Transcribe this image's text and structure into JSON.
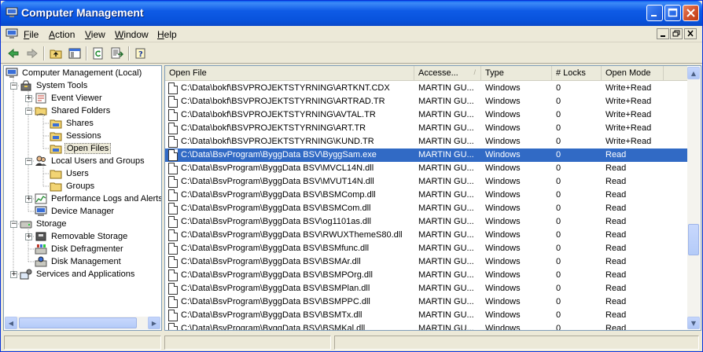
{
  "window": {
    "title": "Computer Management",
    "accent": "#0A5FEE",
    "selection_color": "#316AC5"
  },
  "menu": {
    "items": [
      "File",
      "Action",
      "View",
      "Window",
      "Help"
    ]
  },
  "toolbar": {
    "icons": [
      "back-icon",
      "forward-icon",
      "up-folder-icon",
      "show-hide-tree-icon",
      "refresh-icon",
      "export-list-icon",
      "help-icon"
    ]
  },
  "tree": {
    "items": [
      {
        "label": "Computer Management (Local)",
        "icon": "computer-icon"
      },
      {
        "label": "System Tools",
        "icon": "tools-icon"
      },
      {
        "label": "Event Viewer",
        "icon": "event-viewer-icon"
      },
      {
        "label": "Shared Folders",
        "icon": "shared-folder-icon"
      },
      {
        "label": "Shares",
        "icon": "folder-icon"
      },
      {
        "label": "Sessions",
        "icon": "folder-icon"
      },
      {
        "label": "Open Files",
        "icon": "folder-icon"
      },
      {
        "label": "Local Users and Groups",
        "icon": "users-icon"
      },
      {
        "label": "Users",
        "icon": "folder-icon"
      },
      {
        "label": "Groups",
        "icon": "folder-icon"
      },
      {
        "label": "Performance Logs and Alerts",
        "icon": "performance-icon"
      },
      {
        "label": "Device Manager",
        "icon": "device-manager-icon"
      },
      {
        "label": "Storage",
        "icon": "storage-icon"
      },
      {
        "label": "Removable Storage",
        "icon": "removable-storage-icon"
      },
      {
        "label": "Disk Defragmenter",
        "icon": "defrag-icon"
      },
      {
        "label": "Disk Management",
        "icon": "disk-management-icon"
      },
      {
        "label": "Services and Applications",
        "icon": "services-icon"
      }
    ],
    "selected": "Open Files"
  },
  "list": {
    "columns": [
      "Open File",
      "Accesse...",
      "Type",
      "# Locks",
      "Open Mode"
    ],
    "sorted_column": "Accesse...",
    "rows": [
      {
        "file": "C:\\Data\\bokf\\BSVPROJEKTSTYRNING\\ARTKNT.CDX",
        "accessed_by": "MARTIN GU...",
        "type": "Windows",
        "locks": "0",
        "mode": "Write+Read"
      },
      {
        "file": "C:\\Data\\bokf\\BSVPROJEKTSTYRNING\\ARTRAD.TR",
        "accessed_by": "MARTIN GU...",
        "type": "Windows",
        "locks": "0",
        "mode": "Write+Read"
      },
      {
        "file": "C:\\Data\\bokf\\BSVPROJEKTSTYRNING\\AVTAL.TR",
        "accessed_by": "MARTIN GU...",
        "type": "Windows",
        "locks": "0",
        "mode": "Write+Read"
      },
      {
        "file": "C:\\Data\\bokf\\BSVPROJEKTSTYRNING\\ART.TR",
        "accessed_by": "MARTIN GU...",
        "type": "Windows",
        "locks": "0",
        "mode": "Write+Read"
      },
      {
        "file": "C:\\Data\\bokf\\BSVPROJEKTSTYRNING\\KUND.TR",
        "accessed_by": "MARTIN GU...",
        "type": "Windows",
        "locks": "0",
        "mode": "Write+Read"
      },
      {
        "file": "C:\\Data\\BsvProgram\\ByggData BSV\\ByggSam.exe",
        "accessed_by": "MARTIN GU...",
        "type": "Windows",
        "locks": "0",
        "mode": "Read",
        "selected": true
      },
      {
        "file": "C:\\Data\\BsvProgram\\ByggData BSV\\MVCL14N.dll",
        "accessed_by": "MARTIN GU...",
        "type": "Windows",
        "locks": "0",
        "mode": "Read"
      },
      {
        "file": "C:\\Data\\BsvProgram\\ByggData BSV\\MVUT14N.dll",
        "accessed_by": "MARTIN GU...",
        "type": "Windows",
        "locks": "0",
        "mode": "Read"
      },
      {
        "file": "C:\\Data\\BsvProgram\\ByggData BSV\\BSMComp.dll",
        "accessed_by": "MARTIN GU...",
        "type": "Windows",
        "locks": "0",
        "mode": "Read"
      },
      {
        "file": "C:\\Data\\BsvProgram\\ByggData BSV\\BSMCom.dll",
        "accessed_by": "MARTIN GU...",
        "type": "Windows",
        "locks": "0",
        "mode": "Read"
      },
      {
        "file": "C:\\Data\\BsvProgram\\ByggData BSV\\og1101as.dll",
        "accessed_by": "MARTIN GU...",
        "type": "Windows",
        "locks": "0",
        "mode": "Read"
      },
      {
        "file": "C:\\Data\\BsvProgram\\ByggData BSV\\RWUXThemeS80.dll",
        "accessed_by": "MARTIN GU...",
        "type": "Windows",
        "locks": "0",
        "mode": "Read"
      },
      {
        "file": "C:\\Data\\BsvProgram\\ByggData BSV\\BSMfunc.dll",
        "accessed_by": "MARTIN GU...",
        "type": "Windows",
        "locks": "0",
        "mode": "Read"
      },
      {
        "file": "C:\\Data\\BsvProgram\\ByggData BSV\\BSMAr.dll",
        "accessed_by": "MARTIN GU...",
        "type": "Windows",
        "locks": "0",
        "mode": "Read"
      },
      {
        "file": "C:\\Data\\BsvProgram\\ByggData BSV\\BSMPOrg.dll",
        "accessed_by": "MARTIN GU...",
        "type": "Windows",
        "locks": "0",
        "mode": "Read"
      },
      {
        "file": "C:\\Data\\BsvProgram\\ByggData BSV\\BSMPlan.dll",
        "accessed_by": "MARTIN GU...",
        "type": "Windows",
        "locks": "0",
        "mode": "Read"
      },
      {
        "file": "C:\\Data\\BsvProgram\\ByggData BSV\\BSMPPC.dll",
        "accessed_by": "MARTIN GU...",
        "type": "Windows",
        "locks": "0",
        "mode": "Read"
      },
      {
        "file": "C:\\Data\\BsvProgram\\ByggData BSV\\BSMTx.dll",
        "accessed_by": "MARTIN GU...",
        "type": "Windows",
        "locks": "0",
        "mode": "Read"
      },
      {
        "file": "C:\\Data\\BsvProgram\\ByggData BSV\\BSMKal.dll",
        "accessed_by": "MARTIN GU...",
        "type": "Windows",
        "locks": "0",
        "mode": "Read"
      }
    ]
  }
}
